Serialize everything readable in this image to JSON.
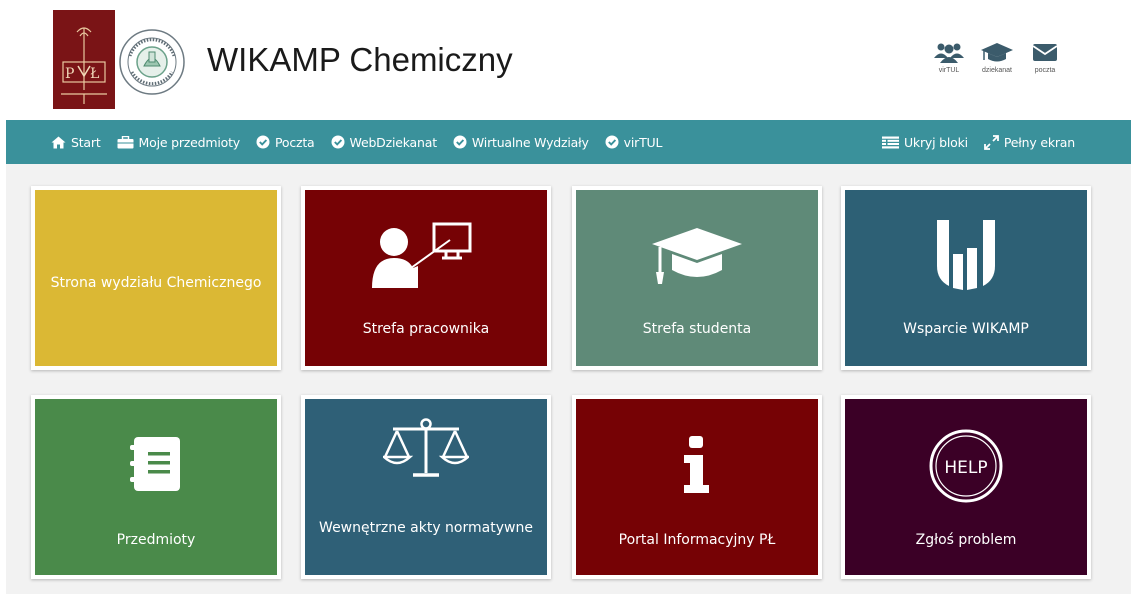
{
  "header": {
    "title": "WIKAMP Chemiczny",
    "quick_links": [
      {
        "label": "virTUL",
        "icon": "users-icon"
      },
      {
        "label": "dziekanat",
        "icon": "graduation-cap-icon"
      },
      {
        "label": "poczta",
        "icon": "envelope-icon"
      }
    ]
  },
  "nav": {
    "left": [
      {
        "label": "Start",
        "icon": "home-icon"
      },
      {
        "label": "Moje przedmioty",
        "icon": "briefcase-icon"
      },
      {
        "label": "Poczta",
        "icon": "check-circle-icon"
      },
      {
        "label": "WebDziekanat",
        "icon": "check-circle-icon"
      },
      {
        "label": "Wirtualne Wydziały",
        "icon": "check-circle-icon"
      },
      {
        "label": "virTUL",
        "icon": "check-circle-icon"
      }
    ],
    "right": [
      {
        "label": "Ukryj bloki",
        "icon": "list-icon"
      },
      {
        "label": "Pełny ekran",
        "icon": "expand-icon"
      }
    ]
  },
  "tiles": [
    {
      "label": "Strona wydziału Chemicznego",
      "color": "#dbb834",
      "icon": "none"
    },
    {
      "label": "Strefa pracownika",
      "color": "#760205",
      "icon": "teacher-icon"
    },
    {
      "label": "Strefa studenta",
      "color": "#5f8a78",
      "icon": "graduation-cap-icon"
    },
    {
      "label": "Wsparcie WIKAMP",
      "color": "#2d6075",
      "icon": "wikamp-logo-icon"
    },
    {
      "label": "Przedmioty",
      "color": "#4a8a4a",
      "icon": "notebook-icon"
    },
    {
      "label": "Wewnętrzne akty normatywne",
      "color": "#2f6077",
      "icon": "scales-icon"
    },
    {
      "label": "Portal Informacyjny PŁ",
      "color": "#760205",
      "icon": "info-icon"
    },
    {
      "label": "Zgłoś problem",
      "color": "#3b0026",
      "icon": "help-icon"
    }
  ],
  "help_icon_text": "HELP",
  "colors": {
    "navbar": "#3a919b",
    "logo": "#7a1416"
  }
}
